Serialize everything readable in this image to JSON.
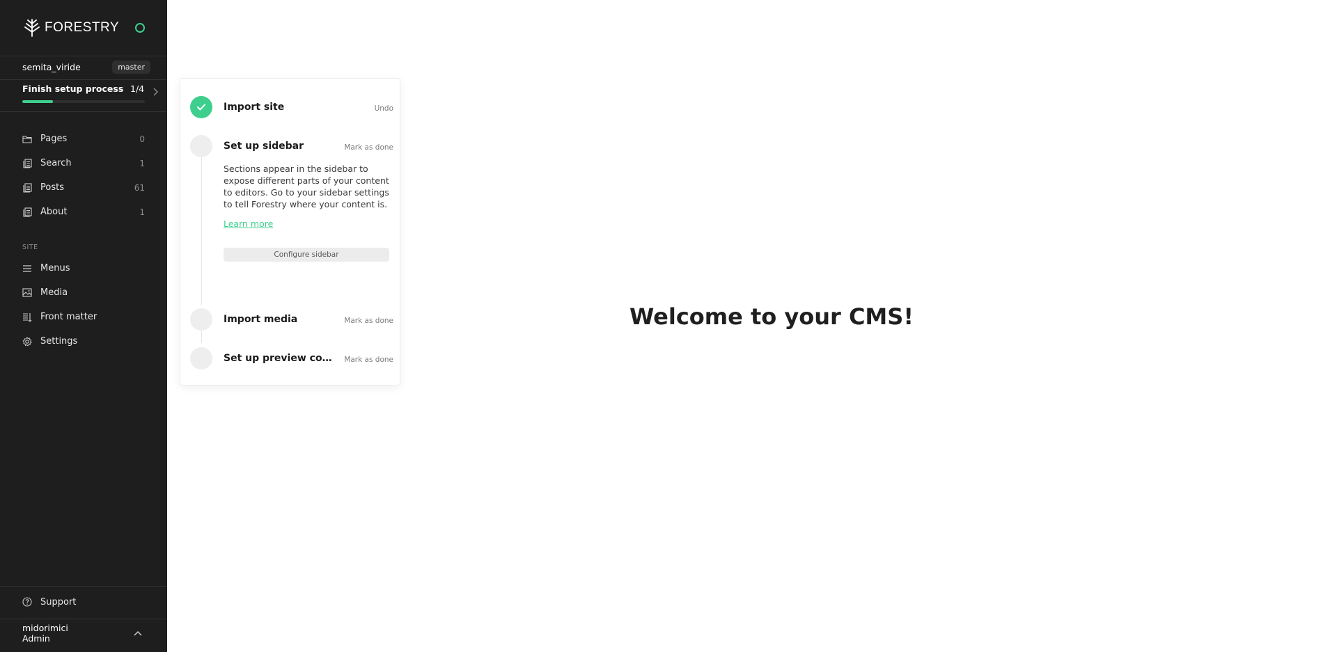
{
  "brand": {
    "name": "FORESTRY",
    "accent": "#3ecf8e",
    "sidebar_bg": "#1e1e1e"
  },
  "site": {
    "name": "semita_viride",
    "branch": "master"
  },
  "setup": {
    "title": "Finish setup process",
    "count": "1/4",
    "progress": 0.25
  },
  "nav": {
    "items": [
      {
        "label": "Pages",
        "count": "0",
        "icon": "folder-icon"
      },
      {
        "label": "Search",
        "count": "1",
        "icon": "document-icon"
      },
      {
        "label": "Posts",
        "count": "61",
        "icon": "document-icon"
      },
      {
        "label": "About",
        "count": "1",
        "icon": "document-icon"
      }
    ]
  },
  "site_section": {
    "label": "SITE",
    "items": [
      {
        "label": "Menus",
        "icon": "menu-icon"
      },
      {
        "label": "Media",
        "icon": "image-icon"
      },
      {
        "label": "Front matter",
        "icon": "front-matter-icon"
      },
      {
        "label": "Settings",
        "icon": "gear-icon"
      }
    ]
  },
  "support": {
    "label": "Support",
    "icon": "help-icon"
  },
  "user": {
    "name": "midorimici",
    "role": "Admin"
  },
  "setup_panel": {
    "steps": [
      {
        "title": "Import site",
        "action": "Undo",
        "done": true
      },
      {
        "title": "Set up sidebar",
        "action": "Mark as done",
        "done": false,
        "description": "Sections appear in the sidebar to expose different parts of your content to editors. Go to your sidebar settings to tell Forestry where your content is.",
        "link": "Learn more",
        "button": "Configure sidebar"
      },
      {
        "title": "Import media",
        "action": "Mark as done",
        "done": false
      },
      {
        "title": "Set up preview com…",
        "action": "Mark as done",
        "done": false
      }
    ]
  },
  "main": {
    "welcome": "Welcome to your CMS!"
  }
}
